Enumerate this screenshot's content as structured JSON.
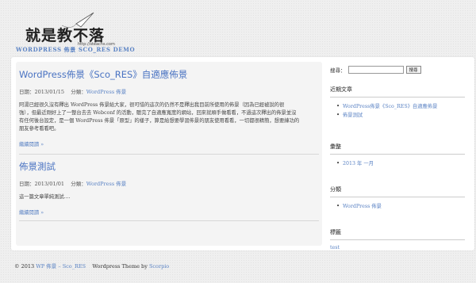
{
  "header": {
    "logo_text": "就是教不落",
    "logo_url": "http://steachs.com",
    "tagline": "WORDPRESS 佈景 SCO_RES DEMO"
  },
  "posts": [
    {
      "title": "WordPress佈景《Sco_RES》自適應佈景",
      "date_label": "日期：",
      "date": "2013/01/15",
      "category_label": "分類：",
      "category": "WordPress 佈景",
      "body_lines": [
        "阿湯已經很久沒有釋出 WordPress 佈景給大家，很可惜的這次的仍然不是釋出我目前所使用的佈景（因為已經被說的很",
        "強），但最近剛好上了一整台去去 Webconf 的活動，聽完了自適應寬度的網站，回來就順手做看看，不過這次釋出的佈景並沒",
        "有任何後台設定，是一個 WordPress 佈景「原型」的樣子，算是給想要學習佈景的朋友使用看看，一切都很精簡，想要練功的",
        "朋友參考看看吧。"
      ],
      "read_more": "繼續閱讀 »"
    },
    {
      "title": "佈景測試",
      "date_label": "日期：",
      "date": "2013/01/01",
      "category_label": "分類：",
      "category": "WordPress 佈景",
      "body_lines": [
        "這一篇文章單純測試...."
      ],
      "read_more": "繼續閱讀 »"
    }
  ],
  "sidebar": {
    "search_label": "搜尋：",
    "search_value": "",
    "search_button": "搜尋",
    "widgets": {
      "recent": {
        "title": "近期文章",
        "items": [
          "WordPress佈景《Sco_RES》自適應佈景",
          "佈景測試"
        ]
      },
      "archive": {
        "title": "彙整",
        "items": [
          "2013 年 一月"
        ]
      },
      "categories": {
        "title": "分類",
        "items": [
          "WordPress 佈景"
        ]
      },
      "tags": {
        "title": "標籤",
        "tag": "test"
      }
    }
  },
  "footer": {
    "copyright": "© 2013",
    "site_link": "WP 佈景 – Sco_RES",
    "theme_text": "Wordpress Theme by",
    "author_link": "Scorpio"
  },
  "colors": {
    "link": "#5b83c4",
    "title": "#4a73c2",
    "background": "#efefef"
  }
}
